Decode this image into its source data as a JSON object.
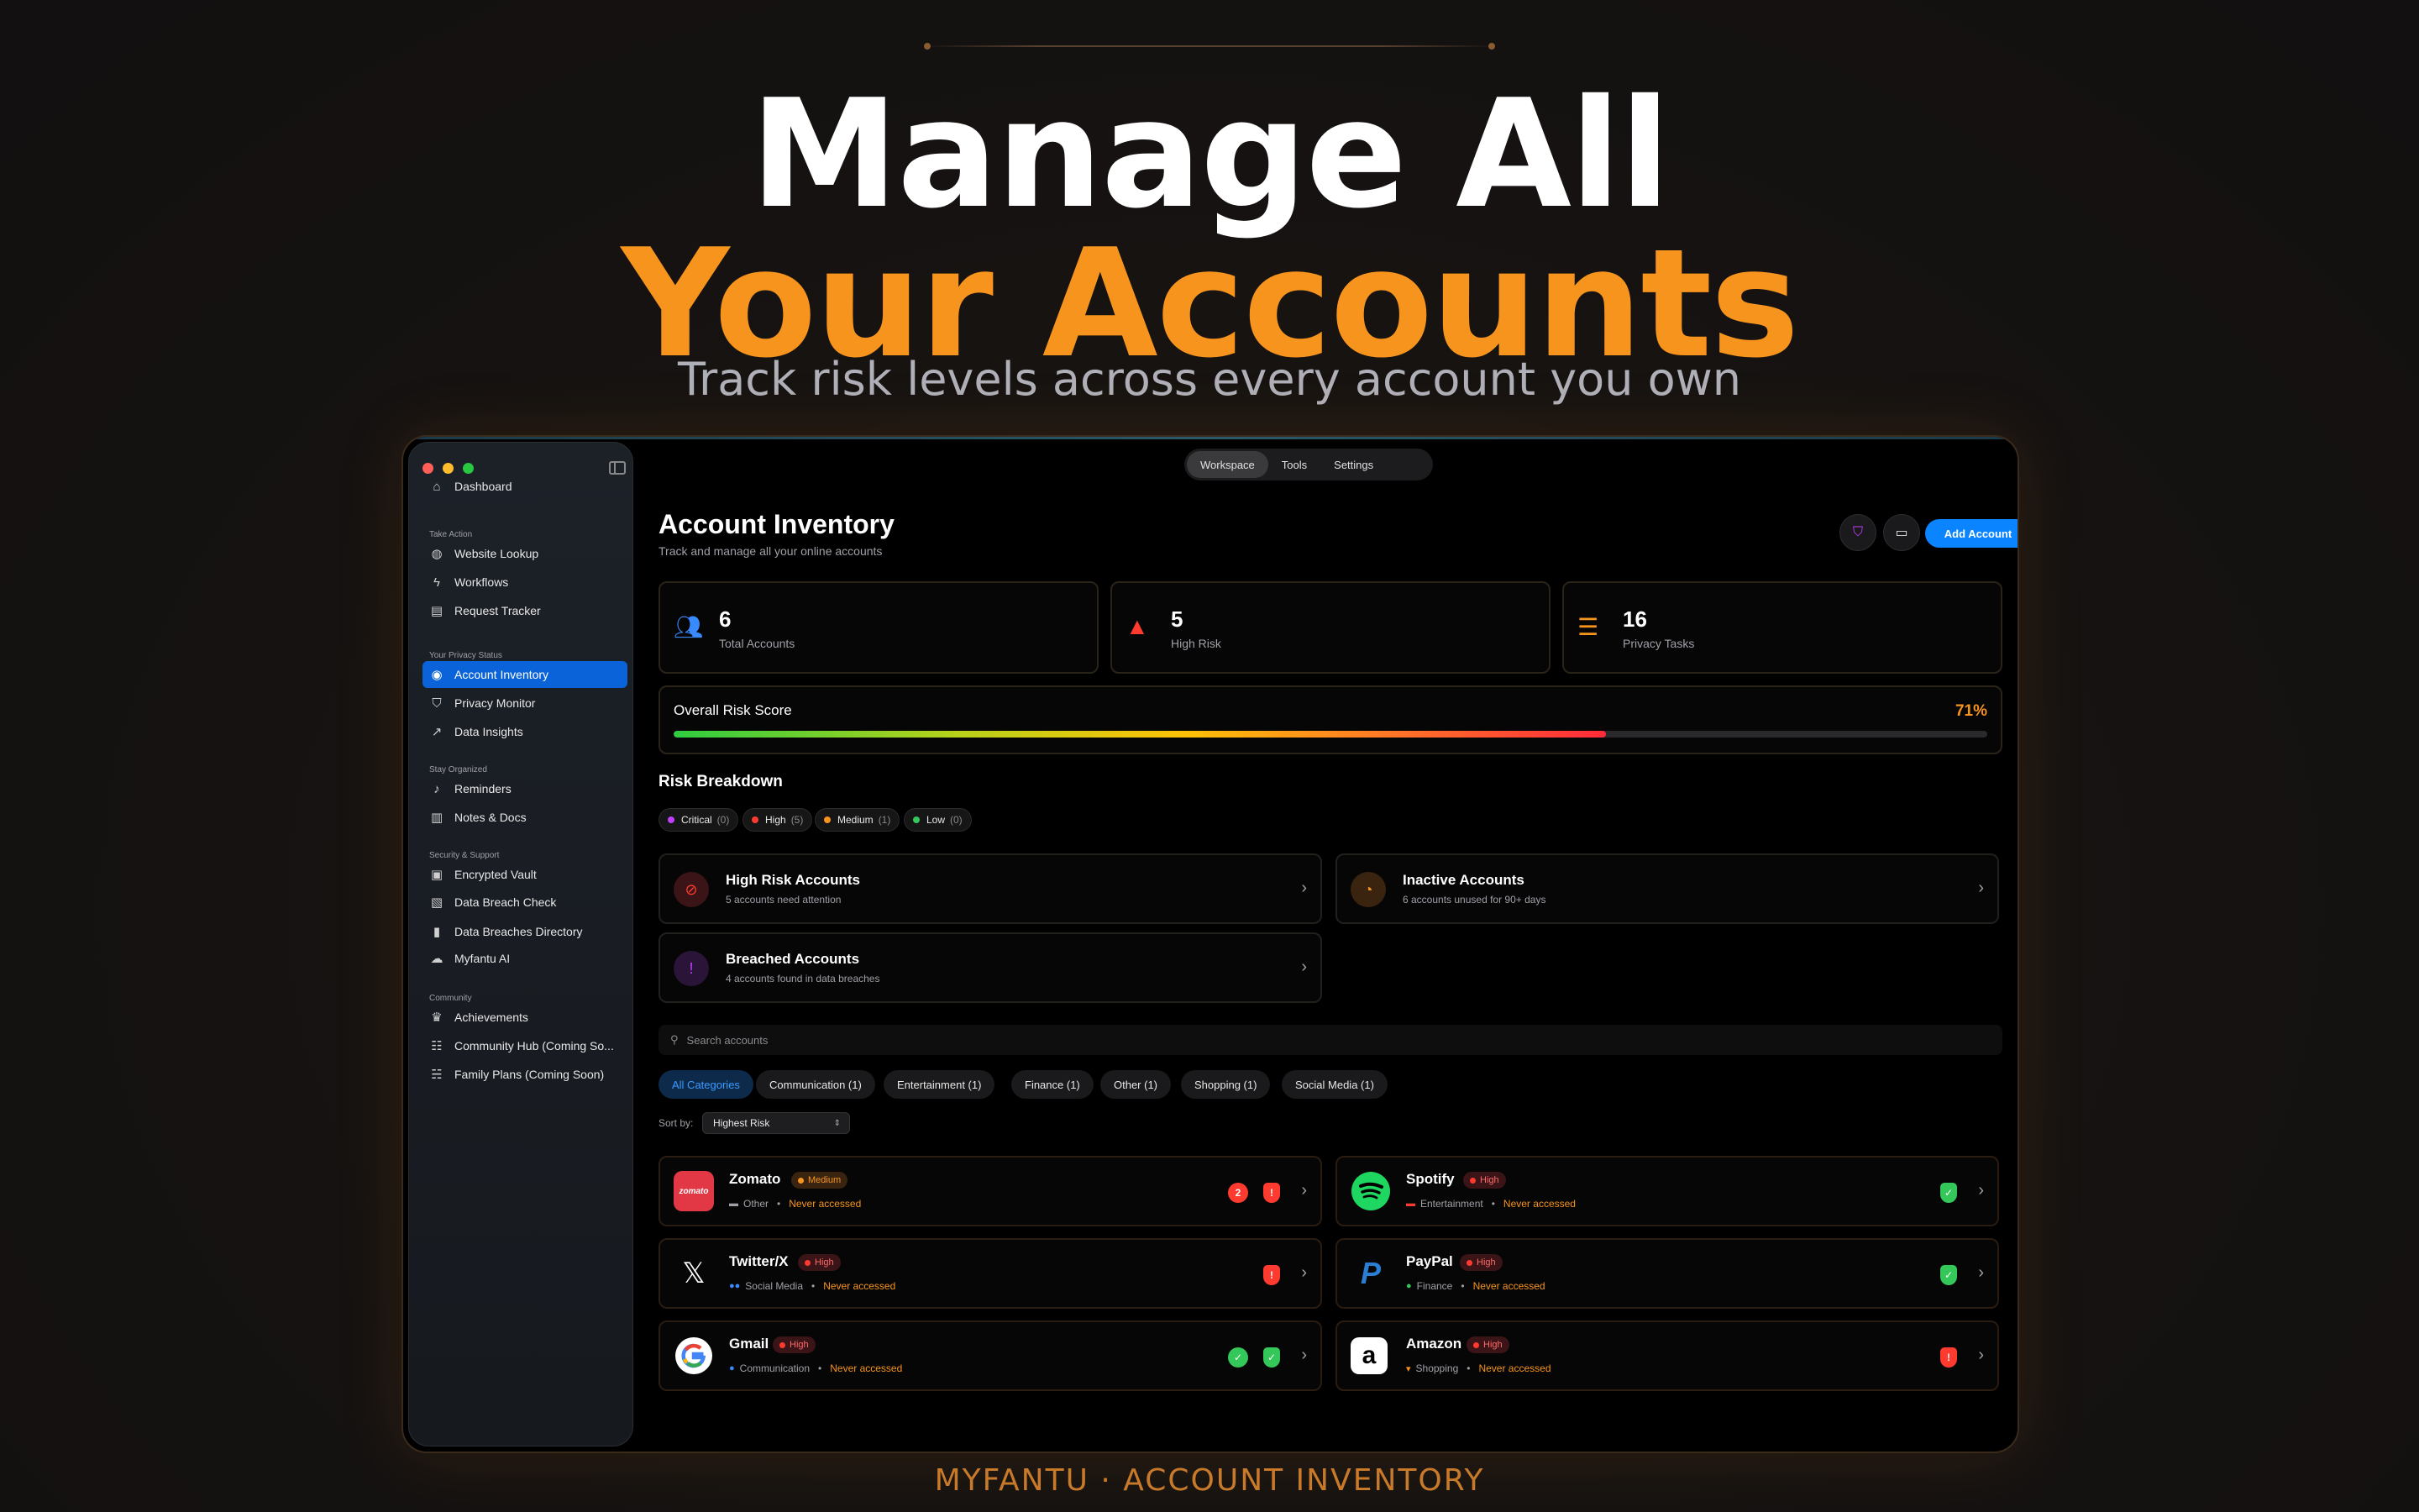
{
  "hero": {
    "line1": "Manage All",
    "line2": "Your Accounts",
    "subtitle": "Track risk levels across every account you own",
    "footer": "MYFANTU · ACCOUNT INVENTORY"
  },
  "colors": {
    "accent": "#f7941d",
    "primary": "#0a84ff",
    "danger": "#ff3b30",
    "success": "#34c759"
  },
  "sidebar": {
    "top": {
      "label": "Dashboard",
      "icon": "house-icon"
    },
    "sections": [
      {
        "title": "Take Action",
        "items": [
          {
            "label": "Website Lookup",
            "icon": "globe-icon"
          },
          {
            "label": "Workflows",
            "icon": "bolt-icon"
          },
          {
            "label": "Request Tracker",
            "icon": "document-icon"
          }
        ]
      },
      {
        "title": "Your Privacy Status",
        "items": [
          {
            "label": "Account Inventory",
            "icon": "person-circle-icon",
            "active": true
          },
          {
            "label": "Privacy Monitor",
            "icon": "shield-icon"
          },
          {
            "label": "Data Insights",
            "icon": "chart-line-icon"
          }
        ]
      },
      {
        "title": "Stay Organized",
        "items": [
          {
            "label": "Reminders",
            "icon": "bell-icon"
          },
          {
            "label": "Notes & Docs",
            "icon": "book-icon"
          }
        ]
      },
      {
        "title": "Security & Support",
        "items": [
          {
            "label": "Encrypted Vault",
            "icon": "lock-icon"
          },
          {
            "label": "Data Breach Check",
            "icon": "doc-shield-icon"
          },
          {
            "label": "Data Breaches Directory",
            "icon": "book-closed-icon"
          },
          {
            "label": "Myfantu AI",
            "icon": "chat-bubbles-icon"
          }
        ]
      },
      {
        "title": "Community",
        "items": [
          {
            "label": "Achievements",
            "icon": "trophy-icon"
          },
          {
            "label": "Community Hub (Coming So...",
            "icon": "people-three-icon"
          },
          {
            "label": "Family Plans (Coming Soon)",
            "icon": "people-two-icon"
          }
        ]
      }
    ]
  },
  "segment": {
    "tabs": [
      "Workspace",
      "Tools",
      "Settings"
    ],
    "active": "Workspace"
  },
  "header": {
    "title": "Account Inventory",
    "subtitle": "Track and manage all your online accounts",
    "add_label": "Add Account"
  },
  "stats": [
    {
      "value": "6",
      "label": "Total Accounts",
      "icon": "people-icon"
    },
    {
      "value": "5",
      "label": "High Risk",
      "icon": "warning-triangle-icon"
    },
    {
      "value": "16",
      "label": "Privacy Tasks",
      "icon": "checklist-icon"
    }
  ],
  "risk_score": {
    "label": "Overall Risk Score",
    "value_text": "71%",
    "fraction": 0.71
  },
  "breakdown": {
    "title": "Risk Breakdown",
    "pills": [
      {
        "label": "Critical",
        "count": "(0)",
        "color": "#c040ff"
      },
      {
        "label": "High",
        "count": "(5)",
        "color": "#ff3b30"
      },
      {
        "label": "Medium",
        "count": "(1)",
        "color": "#f7941d"
      },
      {
        "label": "Low",
        "count": "(0)",
        "color": "#34c759"
      }
    ],
    "cards": [
      {
        "title": "High Risk Accounts",
        "subtitle": "5 accounts need attention",
        "icon": "shield-slash-icon"
      },
      {
        "title": "Inactive Accounts",
        "subtitle": "6 accounts unused for 90+ days",
        "icon": "clock-badge-icon"
      },
      {
        "title": "Breached Accounts",
        "subtitle": "4 accounts found in data breaches",
        "icon": "shield-alert-icon"
      }
    ]
  },
  "search": {
    "placeholder": "Search accounts"
  },
  "categories": [
    "All Categories",
    "Communication (1)",
    "Entertainment (1)",
    "Finance (1)",
    "Other (1)",
    "Shopping (1)",
    "Social Media (1)"
  ],
  "sort": {
    "label": "Sort by:",
    "value": "Highest Risk"
  },
  "accounts": [
    {
      "name": "Zomato",
      "risk": "Medium",
      "category": "Other",
      "access": "Never accessed",
      "breaches": "2"
    },
    {
      "name": "Spotify",
      "risk": "High",
      "category": "Entertainment",
      "access": "Never accessed"
    },
    {
      "name": "Twitter/X",
      "risk": "High",
      "category": "Social Media",
      "access": "Never accessed"
    },
    {
      "name": "PayPal",
      "risk": "High",
      "category": "Finance",
      "access": "Never accessed"
    },
    {
      "name": "Gmail",
      "risk": "High",
      "category": "Communication",
      "access": "Never accessed"
    },
    {
      "name": "Amazon",
      "risk": "High",
      "category": "Shopping",
      "access": "Never accessed"
    }
  ],
  "logos": {
    "zomato": "zomato",
    "amazon": "a"
  },
  "meta_sep": "•"
}
